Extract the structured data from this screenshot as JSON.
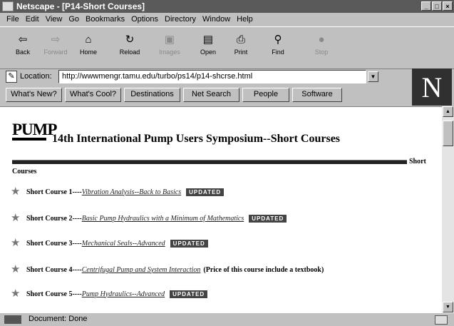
{
  "window": {
    "title": "Netscape - [P14-Short Courses]",
    "controls": [
      "_",
      "□",
      "×"
    ]
  },
  "menu": [
    "File",
    "Edit",
    "View",
    "Go",
    "Bookmarks",
    "Options",
    "Directory",
    "Window",
    "Help"
  ],
  "toolbar": [
    {
      "label": "Back",
      "icon": "back-arrow-icon",
      "enabled": true
    },
    {
      "label": "Forward",
      "icon": "forward-arrow-icon",
      "enabled": false
    },
    {
      "label": "Home",
      "icon": "home-icon",
      "enabled": true
    },
    {
      "label": "Reload",
      "icon": "reload-icon",
      "enabled": true
    },
    {
      "label": "Images",
      "icon": "images-icon",
      "enabled": false
    },
    {
      "label": "Open",
      "icon": "open-icon",
      "enabled": true
    },
    {
      "label": "Print",
      "icon": "print-icon",
      "enabled": true
    },
    {
      "label": "Find",
      "icon": "find-icon",
      "enabled": true
    },
    {
      "label": "Stop",
      "icon": "stop-icon",
      "enabled": false
    }
  ],
  "location": {
    "label": "Location:",
    "url": "http://wwwmengr.tamu.edu/turbo/ps14/p14-shcrse.html"
  },
  "directory_buttons": [
    "What's New?",
    "What's Cool?",
    "Destinations",
    "Net Search",
    "People",
    "Software"
  ],
  "page": {
    "logo_text": "PUMP",
    "title": "14th International Pump Users Symposium--Short Courses",
    "section_label_part1": "Short",
    "section_label_part2": "Courses",
    "updated_badge": "UPDATED",
    "courses": [
      {
        "label": "Short Course 1----",
        "link": "Vibration Analysis--Back to Basics",
        "updated": true,
        "note": ""
      },
      {
        "label": "Short Course 2----",
        "link": "Basic Pump Hydraulics with a Minimum of Mathematics",
        "updated": true,
        "note": ""
      },
      {
        "label": "Short Course 3----",
        "link": "Mechanical Seals--Advanced",
        "updated": true,
        "note": ""
      },
      {
        "label": "Short Course 4----",
        "link": "Centrifugal Pump and System Interaction",
        "updated": false,
        "note": "(Price of this course include a textbook)"
      },
      {
        "label": "Short Course 5----",
        "link": "Pump Hydraulics--Advanced",
        "updated": true,
        "note": ""
      }
    ]
  },
  "status": {
    "text": "Document: Done"
  }
}
